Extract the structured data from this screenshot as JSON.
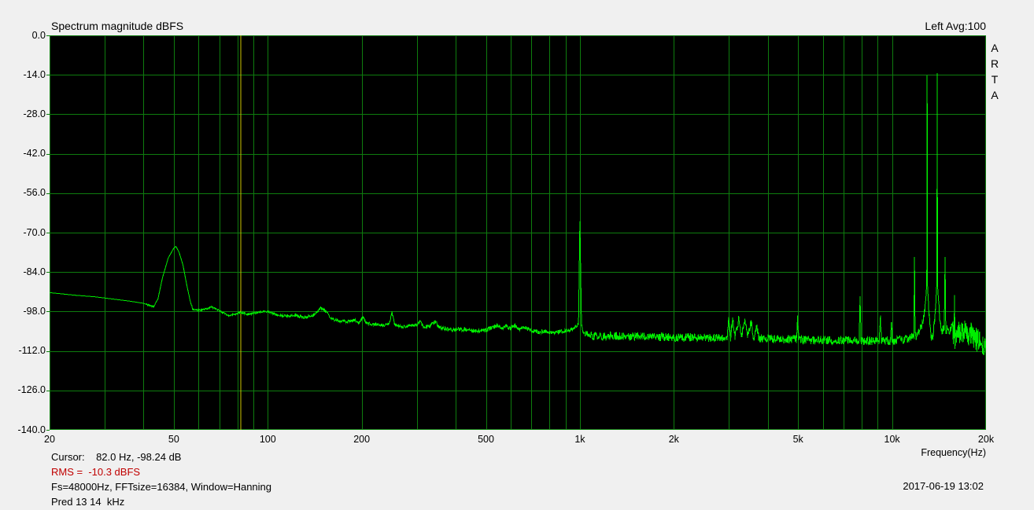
{
  "header": {
    "title": "Spectrum magnitude dBFS",
    "channel_info": "Left  Avg:100"
  },
  "side_label": {
    "text": "ARTA",
    "letters": [
      "A",
      "R",
      "T",
      "A"
    ]
  },
  "status": {
    "cursor_line": "Cursor:    82.0 Hz, -98.24 dB",
    "rms_line": "RMS =  -10.3 dBFS",
    "settings_line": "Fs=48000Hz, FFTsize=16384, Window=Hanning",
    "pred_line": "Pred 13 14  kHz",
    "datetime": "2017-06-19  13:02"
  },
  "chart_data": {
    "type": "line",
    "title": "Spectrum magnitude dBFS",
    "legend": "Left  Avg:100",
    "x_axis": {
      "label": "Frequency(Hz)",
      "scale": "log",
      "min_hz": 20,
      "max_hz": 20000,
      "major_ticks": [
        {
          "hz": 20,
          "label": "20"
        },
        {
          "hz": 50,
          "label": "50"
        },
        {
          "hz": 100,
          "label": "100"
        },
        {
          "hz": 200,
          "label": "200"
        },
        {
          "hz": 500,
          "label": "500"
        },
        {
          "hz": 1000,
          "label": "1k"
        },
        {
          "hz": 2000,
          "label": "2k"
        },
        {
          "hz": 5000,
          "label": "5k"
        },
        {
          "hz": 10000,
          "label": "10k"
        },
        {
          "hz": 20000,
          "label": "20k"
        }
      ]
    },
    "y_axis": {
      "unit": "dBFS",
      "max_db": 0,
      "min_db": -140,
      "tick_step_db": 14,
      "ticks": [
        {
          "db": 0,
          "label": "0.0"
        },
        {
          "db": -14,
          "label": "-14.0"
        },
        {
          "db": -28,
          "label": "-28.0"
        },
        {
          "db": -42,
          "label": "-42.0"
        },
        {
          "db": -56,
          "label": "-56.0"
        },
        {
          "db": -70,
          "label": "-70.0"
        },
        {
          "db": -84,
          "label": "-84.0"
        },
        {
          "db": -98,
          "label": "-98.0"
        },
        {
          "db": -112,
          "label": "-112.0"
        },
        {
          "db": -126,
          "label": "-126.0"
        },
        {
          "db": -140,
          "label": "-140.0"
        }
      ]
    },
    "colors": {
      "plot_bg": "#000000",
      "grid": "#0e7c0e",
      "trace": "#00ee00",
      "cursor": "#cdc400",
      "rms_text": "#c00000",
      "window_bg": "#f0f0f0"
    },
    "cursor": {
      "freq_hz": 82.0,
      "level_dbfs": -98.24
    },
    "notable_peaks": [
      {
        "hz": 50,
        "db": -75
      },
      {
        "hz": 1000,
        "db": -66
      },
      {
        "hz": 8000,
        "db": -92.6
      },
      {
        "hz": 11800,
        "db": -78.7
      },
      {
        "hz": 13000,
        "db": -14.2
      },
      {
        "hz": 14000,
        "db": -13.4
      },
      {
        "hz": 14800,
        "db": -78.7
      }
    ],
    "series": [
      {
        "name": "Left",
        "points": [
          [
            20,
            -91.3
          ],
          [
            24,
            -92.2
          ],
          [
            28,
            -92.8
          ],
          [
            32,
            -93.6
          ],
          [
            36,
            -94.3
          ],
          [
            40,
            -95.1
          ],
          [
            43,
            -96.4
          ],
          [
            44.5,
            -93.5
          ],
          [
            46,
            -86
          ],
          [
            48,
            -79
          ],
          [
            50,
            -75.5
          ],
          [
            50.8,
            -74.9
          ],
          [
            52,
            -77
          ],
          [
            53.5,
            -81.5
          ],
          [
            55,
            -88.5
          ],
          [
            56.5,
            -94.5
          ],
          [
            57.5,
            -97.3
          ],
          [
            60,
            -97.6
          ],
          [
            63,
            -97.2
          ],
          [
            66,
            -96.4
          ],
          [
            69,
            -97.3
          ],
          [
            72,
            -98.5
          ],
          [
            75,
            -99.4
          ],
          [
            78,
            -99
          ],
          [
            82,
            -98.24
          ],
          [
            86,
            -99
          ],
          [
            90,
            -98.6
          ],
          [
            95,
            -98.1
          ],
          [
            100,
            -97.9
          ],
          [
            107,
            -99.3
          ],
          [
            115,
            -99.6
          ],
          [
            122,
            -99.2
          ],
          [
            130,
            -100.2
          ],
          [
            140,
            -99.4
          ],
          [
            148,
            -96.6
          ],
          [
            152,
            -97.5
          ],
          [
            160,
            -100.6
          ],
          [
            170,
            -101.4
          ],
          [
            180,
            -101.6
          ],
          [
            190,
            -101
          ],
          [
            196,
            -102
          ],
          [
            202,
            -99.9
          ],
          [
            208,
            -102.3
          ],
          [
            220,
            -102.5
          ],
          [
            235,
            -103
          ],
          [
            246,
            -102
          ],
          [
            250,
            -98.1
          ],
          [
            255,
            -102.5
          ],
          [
            270,
            -103.6
          ],
          [
            285,
            -103.1
          ],
          [
            300,
            -103
          ],
          [
            308,
            -101.4
          ],
          [
            316,
            -103.6
          ],
          [
            330,
            -103.4
          ],
          [
            345,
            -101.6
          ],
          [
            355,
            -103.8
          ],
          [
            370,
            -104.2
          ],
          [
            390,
            -104.6
          ],
          [
            410,
            -104.2
          ],
          [
            430,
            -104.4
          ],
          [
            450,
            -104.8
          ],
          [
            470,
            -105
          ],
          [
            500,
            -104.6
          ],
          [
            520,
            -103.8
          ],
          [
            545,
            -102.9
          ],
          [
            560,
            -104
          ],
          [
            580,
            -103.2
          ],
          [
            600,
            -104
          ],
          [
            620,
            -102.9
          ],
          [
            640,
            -104.3
          ],
          [
            660,
            -103.5
          ],
          [
            700,
            -105
          ],
          [
            740,
            -105.3
          ],
          [
            780,
            -105
          ],
          [
            820,
            -105.6
          ],
          [
            860,
            -105.2
          ],
          [
            900,
            -105
          ],
          [
            940,
            -104.4
          ],
          [
            970,
            -103.6
          ],
          [
            990,
            -102
          ],
          [
            1000,
            -65.9
          ],
          [
            1012,
            -102.5
          ],
          [
            1030,
            -105.5
          ],
          [
            1060,
            -106.3
          ],
          [
            1100,
            -106.6
          ],
          [
            1200,
            -106.9
          ],
          [
            1300,
            -106.6
          ],
          [
            1400,
            -107.1
          ],
          [
            1500,
            -106.8
          ],
          [
            1700,
            -107.2
          ],
          [
            1900,
            -107
          ],
          [
            2100,
            -107.3
          ],
          [
            2300,
            -107.1
          ],
          [
            2600,
            -107.4
          ],
          [
            2900,
            -107.2
          ],
          [
            2960,
            -107
          ],
          [
            3000,
            -100.6
          ],
          [
            3040,
            -107.2
          ],
          [
            3090,
            -100.3
          ],
          [
            3140,
            -107.3
          ],
          [
            3230,
            -100.6
          ],
          [
            3290,
            -107.2
          ],
          [
            3380,
            -101
          ],
          [
            3440,
            -107.3
          ],
          [
            3540,
            -101.6
          ],
          [
            3600,
            -107.4
          ],
          [
            3690,
            -103.6
          ],
          [
            3750,
            -107.5
          ],
          [
            3900,
            -107.4
          ],
          [
            4100,
            -107.6
          ],
          [
            4400,
            -107.8
          ],
          [
            4700,
            -107.9
          ],
          [
            4940,
            -107.8
          ],
          [
            4980,
            -100.7
          ],
          [
            5030,
            -107.9
          ],
          [
            5300,
            -108
          ],
          [
            5600,
            -108.2
          ],
          [
            6000,
            -108
          ],
          [
            6400,
            -108.3
          ],
          [
            6800,
            -108.2
          ],
          [
            7200,
            -108.4
          ],
          [
            7600,
            -108.3
          ],
          [
            7850,
            -108.4
          ],
          [
            7900,
            -92.6
          ],
          [
            7960,
            -108.4
          ],
          [
            8300,
            -108.4
          ],
          [
            8700,
            -108.5
          ],
          [
            9100,
            -108.4
          ],
          [
            9180,
            -100.6
          ],
          [
            9260,
            -108.5
          ],
          [
            9600,
            -108.4
          ],
          [
            9900,
            -108.3
          ],
          [
            9950,
            -101.2
          ],
          [
            10010,
            -108.4
          ],
          [
            10300,
            -108.3
          ],
          [
            10700,
            -108.1
          ],
          [
            11000,
            -107.9
          ],
          [
            11300,
            -107.6
          ],
          [
            11600,
            -107.2
          ],
          [
            11750,
            -106.9
          ],
          [
            11800,
            -78.7
          ],
          [
            11860,
            -106.8
          ],
          [
            12000,
            -106.4
          ],
          [
            12200,
            -105.3
          ],
          [
            12400,
            -103.6
          ],
          [
            12600,
            -100.8
          ],
          [
            12750,
            -97
          ],
          [
            12850,
            -92.5
          ],
          [
            12920,
            -88
          ],
          [
            12955,
            -14.2
          ],
          [
            12990,
            -88.5
          ],
          [
            13060,
            -93.5
          ],
          [
            13160,
            -99
          ],
          [
            13260,
            -104
          ],
          [
            13360,
            -107.3
          ],
          [
            13420,
            -107.8
          ],
          [
            13560,
            -105.5
          ],
          [
            13680,
            -101.5
          ],
          [
            13790,
            -96.5
          ],
          [
            13870,
            -91
          ],
          [
            13920,
            -87.5
          ],
          [
            13955,
            -13.4
          ],
          [
            13990,
            -88.5
          ],
          [
            14060,
            -92.5
          ],
          [
            14160,
            -97.5
          ],
          [
            14260,
            -101.5
          ],
          [
            14380,
            -103.8
          ],
          [
            14550,
            -104.3
          ],
          [
            14700,
            -104.6
          ],
          [
            14790,
            -78.7
          ],
          [
            14860,
            -104.8
          ],
          [
            15000,
            -104.7
          ],
          [
            15200,
            -104.6
          ],
          [
            15450,
            -104
          ],
          [
            15650,
            -103.3
          ],
          [
            15800,
            -102.5
          ],
          [
            15850,
            -92.2
          ],
          [
            15900,
            -102.4
          ],
          [
            16100,
            -101.6
          ],
          [
            16400,
            -100.9
          ],
          [
            16700,
            -100.5
          ],
          [
            17000,
            -100.3
          ],
          [
            17300,
            -100.6
          ],
          [
            17600,
            -101.1
          ],
          [
            17900,
            -101.7
          ],
          [
            18300,
            -102.7
          ],
          [
            18700,
            -103.7
          ],
          [
            19100,
            -104.8
          ],
          [
            19500,
            -105.9
          ],
          [
            20000,
            -107.4
          ]
        ]
      }
    ]
  }
}
